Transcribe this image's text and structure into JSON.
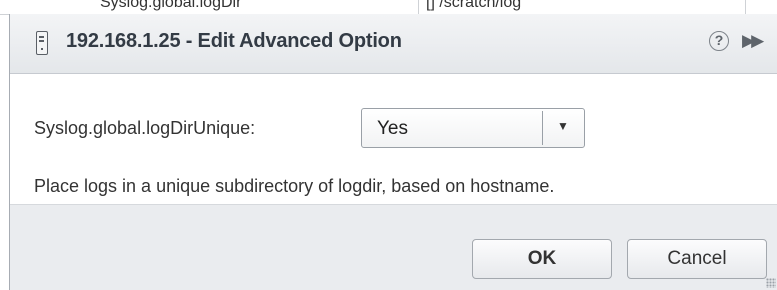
{
  "background_table": {
    "cells": [
      "Syslog.global.logDir",
      "[] /scratch/log"
    ]
  },
  "dialog": {
    "title": "192.168.1.25 - Edit Advanced Option",
    "icons": {
      "host": "host-icon",
      "help": "help-icon",
      "expand": "expand-icon"
    },
    "help_glyph": "?",
    "expand_glyph": "▶▶",
    "field": {
      "label": "Syslog.global.logDirUnique:",
      "selected_value": "Yes",
      "arrow_glyph": "▼"
    },
    "description": "Place logs in a unique subdirectory of logdir, based on hostname.",
    "buttons": {
      "ok": "OK",
      "cancel": "Cancel"
    }
  },
  "colors": {
    "titlebar": "#e4e7ea",
    "footer": "#eaecef",
    "border": "#a7acb3",
    "text": "#333333"
  }
}
